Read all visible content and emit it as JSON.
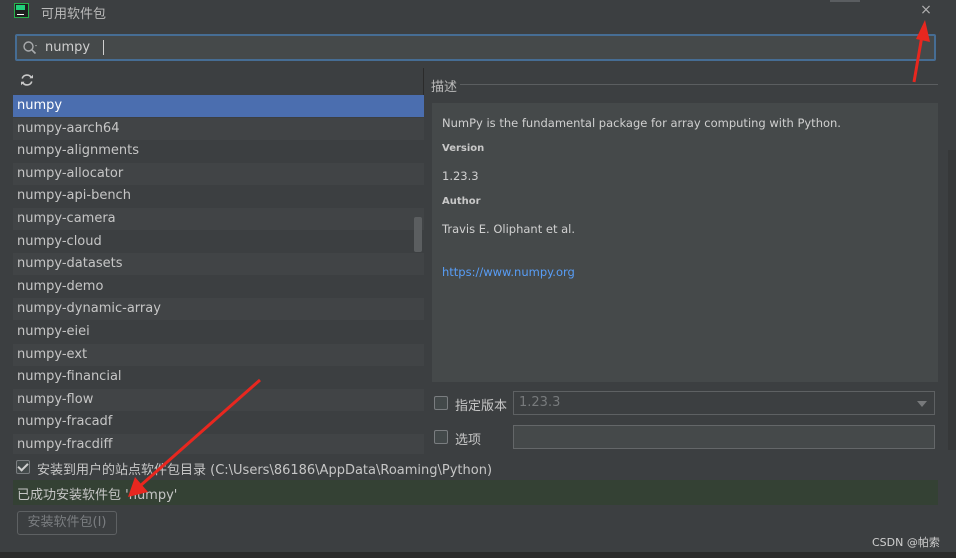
{
  "window": {
    "title": "可用软件包",
    "close_glyph": "×"
  },
  "search": {
    "value": "numpy",
    "icon": "search-icon"
  },
  "list": {
    "refresh_icon": "refresh-icon",
    "selected": "numpy",
    "items": [
      "numpy",
      "numpy-aarch64",
      "numpy-alignments",
      "numpy-allocator",
      "numpy-api-bench",
      "numpy-camera",
      "numpy-cloud",
      "numpy-datasets",
      "numpy-demo",
      "numpy-dynamic-array",
      "numpy-eiei",
      "numpy-ext",
      "numpy-financial",
      "numpy-flow",
      "numpy-fracadf",
      "numpy-fracdiff"
    ]
  },
  "description": {
    "label": "描述",
    "summary": "NumPy is the fundamental package for array computing with Python.",
    "version_label": "Version",
    "version": "1.23.3",
    "author_label": "Author",
    "author": "Travis E. Oliphant et al.",
    "link": "https://www.numpy.org"
  },
  "options": {
    "specify_version_label": "指定版本",
    "version_value": "1.23.3",
    "options_label": "选项",
    "options_value": ""
  },
  "install_to_user": {
    "checked": true,
    "label": "安装到用户的站点软件包目录 (C:\\Users\\86186\\AppData\\Roaming\\Python)"
  },
  "status": {
    "message": "已成功安装软件包 'numpy'",
    "color": "#344134"
  },
  "buttons": {
    "install": "安装软件包(I)"
  },
  "watermark": "CSDN @帕索",
  "colors": {
    "selection": "#4b6eaf",
    "link": "#589df6",
    "arrow": "#e8271f",
    "background": "#3c3f41"
  }
}
